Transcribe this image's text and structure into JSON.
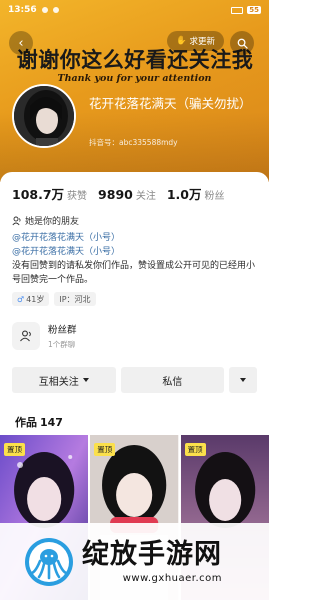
{
  "status_bar": {
    "time": "13:56",
    "battery": "55"
  },
  "header": {
    "update_label": "求更新",
    "banner_cn": "谢谢你这么好看还关注我",
    "banner_en": "Thank you for your attention",
    "nickname": "花开花落花满天（骗关勿扰）",
    "douyin_id": "抖音号：abc335588mdy"
  },
  "stats": [
    {
      "value": "108.7万",
      "label": "获赞"
    },
    {
      "value": "9890",
      "label": "关注"
    },
    {
      "value": "1.0万",
      "label": "粉丝"
    }
  ],
  "friend_label": "她是你的朋友",
  "bio": {
    "link1": "@花开花落花满天（小号）",
    "link2": "@花开花落花满天（小号）",
    "text": "没有回赞到的请私发你们作品，赞设置成公开可见的已经用小号回赞完一个作品。"
  },
  "tags": {
    "age": "41岁",
    "location": "IP：河北"
  },
  "fan_group": {
    "title": "粉丝群",
    "subtitle": "1个群聊"
  },
  "actions": {
    "follow": "互相关注",
    "message": "私信"
  },
  "works": {
    "label": "作品",
    "count": "147"
  },
  "thumbnails": [
    {
      "pin": "置顶"
    },
    {
      "pin": "置顶"
    },
    {
      "pin": "置顶"
    }
  ],
  "watermark": {
    "title": "绽放手游网",
    "url": "www.gxhuaer.com"
  },
  "colors": {
    "header_orange": "#e79a1c",
    "link_blue": "#3a6ea5",
    "pin_yellow": "#fbe04b"
  }
}
